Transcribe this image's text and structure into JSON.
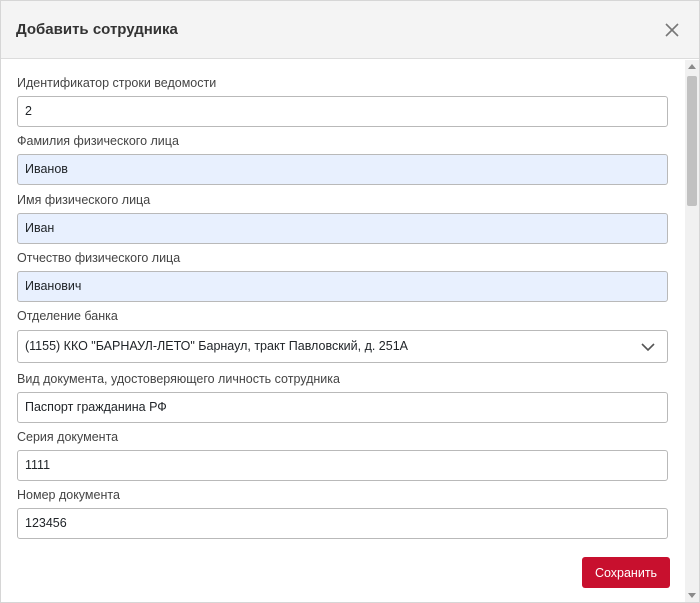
{
  "dialog": {
    "title": "Добавить сотрудника",
    "close_icon": "close-icon"
  },
  "fields": {
    "row_id": {
      "label": "Идентификатор строки ведомости",
      "value": "2"
    },
    "last_name": {
      "label": "Фамилия физического лица",
      "value": "Иванов"
    },
    "first_name": {
      "label": "Имя физического лица",
      "value": "Иван"
    },
    "patronymic": {
      "label": "Отчество физического лица",
      "value": "Иванович"
    },
    "bank_branch": {
      "label": "Отделение банка",
      "value": "(1155) ККО \"БАРНАУЛ-ЛЕТО\" Барнаул, тракт Павловский, д. 251А",
      "icon": "chevron-down-icon"
    },
    "doc_type": {
      "label": "Вид документа, удостоверяющего личность сотрудника",
      "value": "Паспорт гражданина РФ"
    },
    "doc_series": {
      "label": "Серия документа",
      "value": "1111"
    },
    "doc_number": {
      "label": "Номер документа",
      "value": "123456"
    }
  },
  "footer": {
    "save_label": "Сохранить"
  },
  "colors": {
    "accent": "#c8102e",
    "autofill": "#e8f0fe"
  }
}
